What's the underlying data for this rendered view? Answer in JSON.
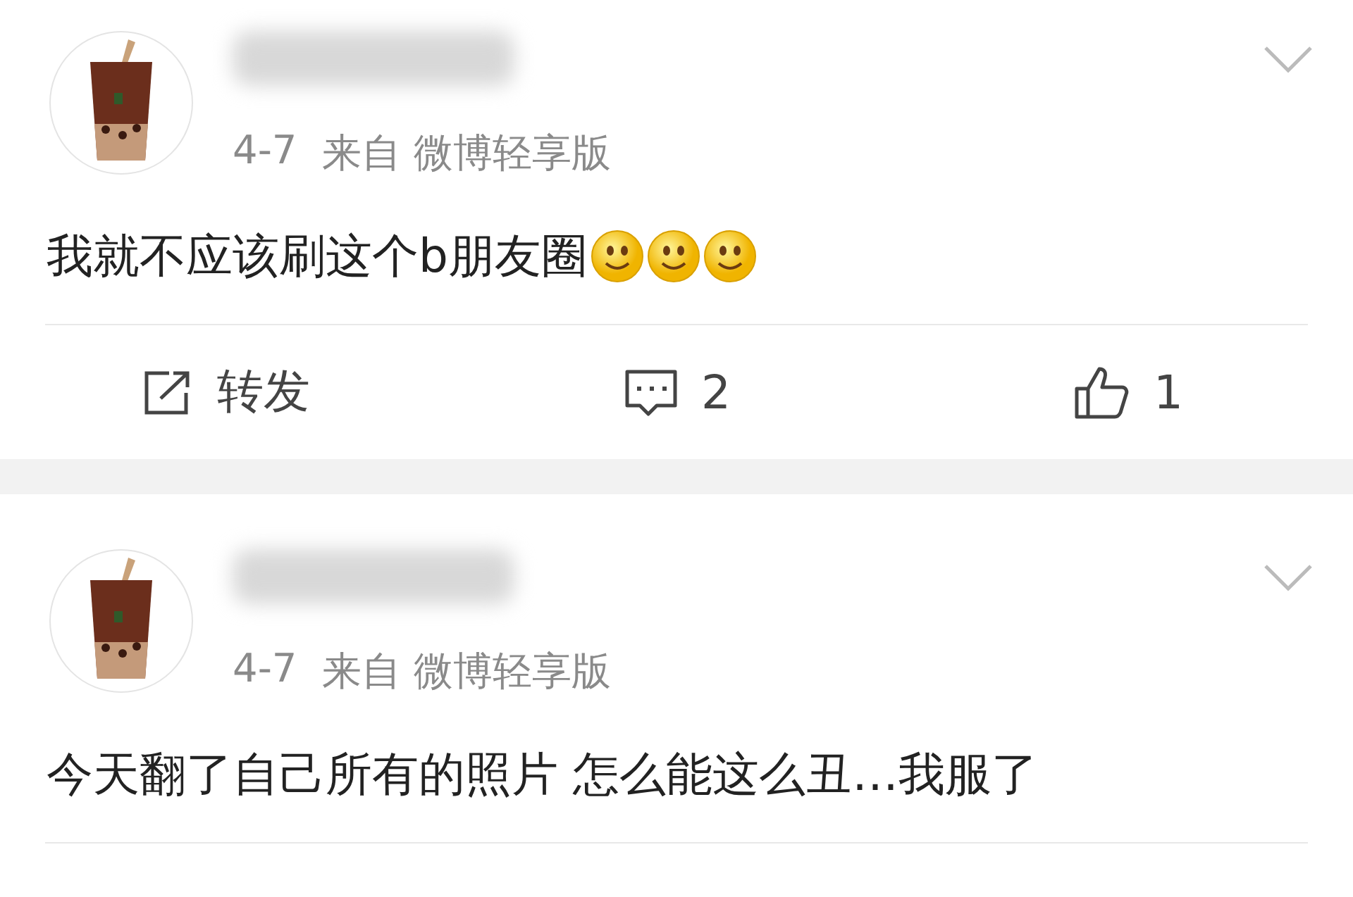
{
  "posts": [
    {
      "time": "4-7",
      "source": "来自 微博轻享版",
      "text": "我就不应该刷这个b朋友圈",
      "emoji": [
        {
          "kind": "smile"
        },
        {
          "kind": "smile"
        },
        {
          "kind": "smile"
        }
      ],
      "actions": [
        {
          "kind": "repost",
          "label": "转发"
        },
        {
          "kind": "comment",
          "label": "2"
        },
        {
          "kind": "like",
          "label": "1"
        }
      ]
    },
    {
      "time": "4-7",
      "source": "来自 微博轻享版",
      "text": "今天翻了自己所有的照片 怎么能这么丑…我服了"
    }
  ]
}
